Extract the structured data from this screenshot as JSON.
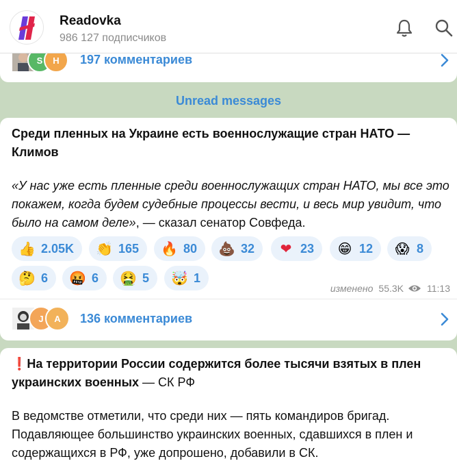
{
  "header": {
    "title": "Readovka",
    "subscribers": "986 127 подписчиков",
    "bell_icon": "bell-icon",
    "search_icon": "search-icon",
    "brand_colors": {
      "red": "#e0244a",
      "purple": "#6a3bd9"
    }
  },
  "prev_post": {
    "comments_label": "197 комментариев",
    "avatars": [
      "S",
      "H"
    ]
  },
  "unread_label": "Unread messages",
  "post1": {
    "title": "Среди пленных на Украине есть военнослужащие стран НАТО — Климов",
    "quote": "«У нас уже есть пленные среди военнослужащих стран НАТО, мы все это покажем, когда будем судебные процессы вести, и весь мир увидит, что было на самом деле»",
    "attribution": ", — сказал сенатор Совфеда.",
    "reactions": [
      {
        "emoji": "👍",
        "count": "2.05K"
      },
      {
        "emoji": "👏",
        "count": "165"
      },
      {
        "emoji": "🔥",
        "count": "80"
      },
      {
        "emoji": "💩",
        "count": "32"
      },
      {
        "emoji": "❤",
        "count": "23"
      },
      {
        "emoji": "😁",
        "count": "12"
      },
      {
        "emoji": "😱",
        "count": "8"
      },
      {
        "emoji": "🤔",
        "count": "6"
      },
      {
        "emoji": "🤬",
        "count": "6"
      },
      {
        "emoji": "🤮",
        "count": "5"
      },
      {
        "emoji": "🤯",
        "count": "1"
      }
    ],
    "edited_label": "изменено",
    "views": "55.3K",
    "time": "11:13",
    "comments_label": "136 комментариев",
    "avatars": [
      "J",
      "A"
    ]
  },
  "post2": {
    "title_mark": "❗",
    "title_bold": "На территории России содержится более тысячи взятых в плен украинских военных",
    "title_tail": " — СК РФ",
    "body": "В ведомстве отметили, что среди них — пять командиров бригад. Подавляющее большинство украинских военных, сдавшихся в плен и содержащихся в РФ, уже допрошено, добавили в СК."
  },
  "colors": {
    "link_blue": "#3b8ad6",
    "reaction_bg": "#eaf2fb",
    "chat_bg": "#c8d9c0"
  }
}
